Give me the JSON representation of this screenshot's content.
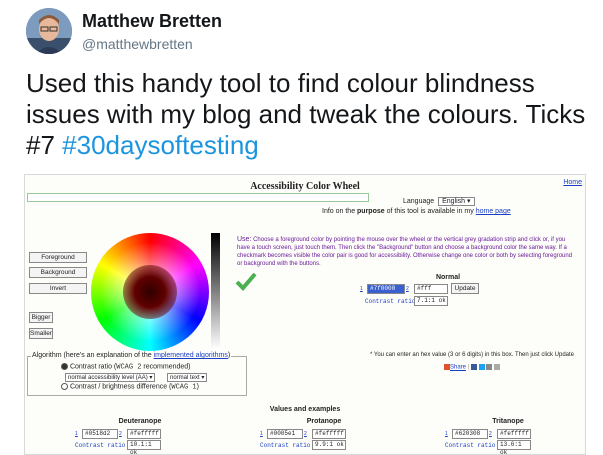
{
  "tweet": {
    "author_name": "Matthew Bretten",
    "author_handle": "@matthewbretten",
    "text": "Used this handy tool to find colour blindness issues with my blog and tweak the colours. Ticks #7 ",
    "hashtag": "#30daysoftesting"
  },
  "tool": {
    "title": "Accessibility Color Wheel",
    "home_link": "Home",
    "language_label": "Language",
    "language_value": "English",
    "info_prefix": "Info on the ",
    "info_bold": "purpose",
    "info_mid": " of this tool is available in my ",
    "info_link": "home page",
    "buttons": {
      "foreground": "Foreground",
      "background": "Background",
      "invert": "Invert",
      "bigger": "Bigger",
      "smaller": "Smaller",
      "update": "Update"
    },
    "use_label": "Use:",
    "use_text": " Choose a foreground color by pointing the mouse over the wheel or the vertical grey gradation strip and click or, if you have a touch screen, just touch them. Then click the \"Background\" button and choose a background color the same way. If a checkmark becomes visible the color pair is good for accessibility. Otherwise change one color or both by selecting foreground or background with the buttons.",
    "normal": {
      "title": "Normal",
      "fg_num": "1",
      "fg_value": "#7f0000",
      "bg_num": "2",
      "bg_value": "#fff",
      "contrast_label": "Contrast ratio",
      "contrast_value": "7.1:1 ok"
    },
    "algorithm": {
      "legend_prefix": "Algorithm (here's an explanation of the ",
      "legend_link": "implemented algorithms",
      "legend_suffix": ")",
      "option1_prefix": "Contrast ratio (",
      "option1_code": "WCAG 2",
      "option1_suffix": " recommended)",
      "level_value": "normal accessibility level (AA)",
      "text_value": "normal text",
      "option2_prefix": "Contrast / brightness difference (",
      "option2_code": "WCAG 1",
      "option2_suffix": ")"
    },
    "hex_note": "* You can enter an hex value (3 or 6 digits) in this box. Then just click Update",
    "share_label": "Share",
    "values_title": "Values and examples",
    "deficiencies": [
      {
        "name": "Deuteranope",
        "fg_num": "1",
        "fg_value": "#0518d2",
        "bg_num": "2",
        "bg_value": "#fefffff",
        "contrast_label": "Contrast ratio",
        "contrast_value": "10.1:1 ok"
      },
      {
        "name": "Protanope",
        "fg_num": "1",
        "fg_value": "#0005e1",
        "bg_num": "2",
        "bg_value": "#fefffff",
        "contrast_label": "Contrast ratio",
        "contrast_value": "9.9:1 ok"
      },
      {
        "name": "Tritanope",
        "fg_num": "1",
        "fg_value": "#620308",
        "bg_num": "2",
        "bg_value": "#fefffff",
        "contrast_label": "Contrast ratio",
        "contrast_value": "13.6:1 ok"
      }
    ],
    "colors": {
      "tick": "#4caf50",
      "link": "#1a3fc4",
      "purple_text": "#6a1b9a"
    }
  }
}
